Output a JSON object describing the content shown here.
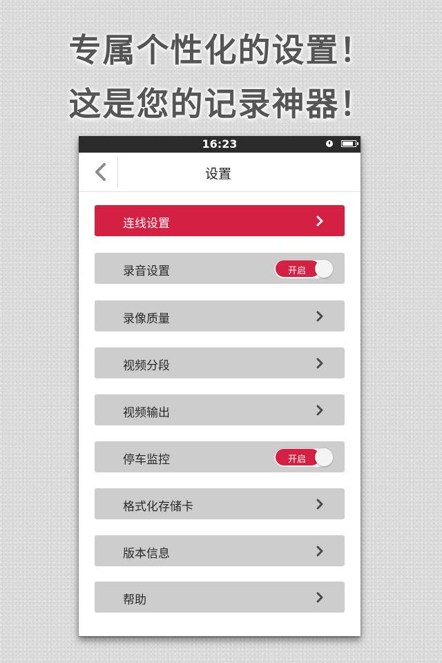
{
  "promo": {
    "line1": "专属个性化的设置！",
    "line2": "这是您的记录神器！"
  },
  "status_bar": {
    "time": "16:23"
  },
  "nav": {
    "title": "设置"
  },
  "menu": [
    {
      "label": "连线设置",
      "type": "link",
      "active": true
    },
    {
      "label": "录音设置",
      "type": "toggle",
      "toggle_text": "开启",
      "on": true
    },
    {
      "label": "录像质量",
      "type": "link"
    },
    {
      "label": "视频分段",
      "type": "link"
    },
    {
      "label": "视频输出",
      "type": "link"
    },
    {
      "label": "停车监控",
      "type": "toggle",
      "toggle_text": "开启",
      "on": true
    },
    {
      "label": "格式化存储卡",
      "type": "link"
    },
    {
      "label": "版本信息",
      "type": "link"
    },
    {
      "label": "帮助",
      "type": "link"
    }
  ],
  "colors": {
    "accent": "#d42042",
    "item_bg": "#cdcdcd",
    "status_bar": "#2b2b2b"
  },
  "icons": {
    "back": "chevron-left-icon",
    "row": "chevron-right-icon",
    "clock": "clock-icon",
    "battery": "battery-icon"
  }
}
